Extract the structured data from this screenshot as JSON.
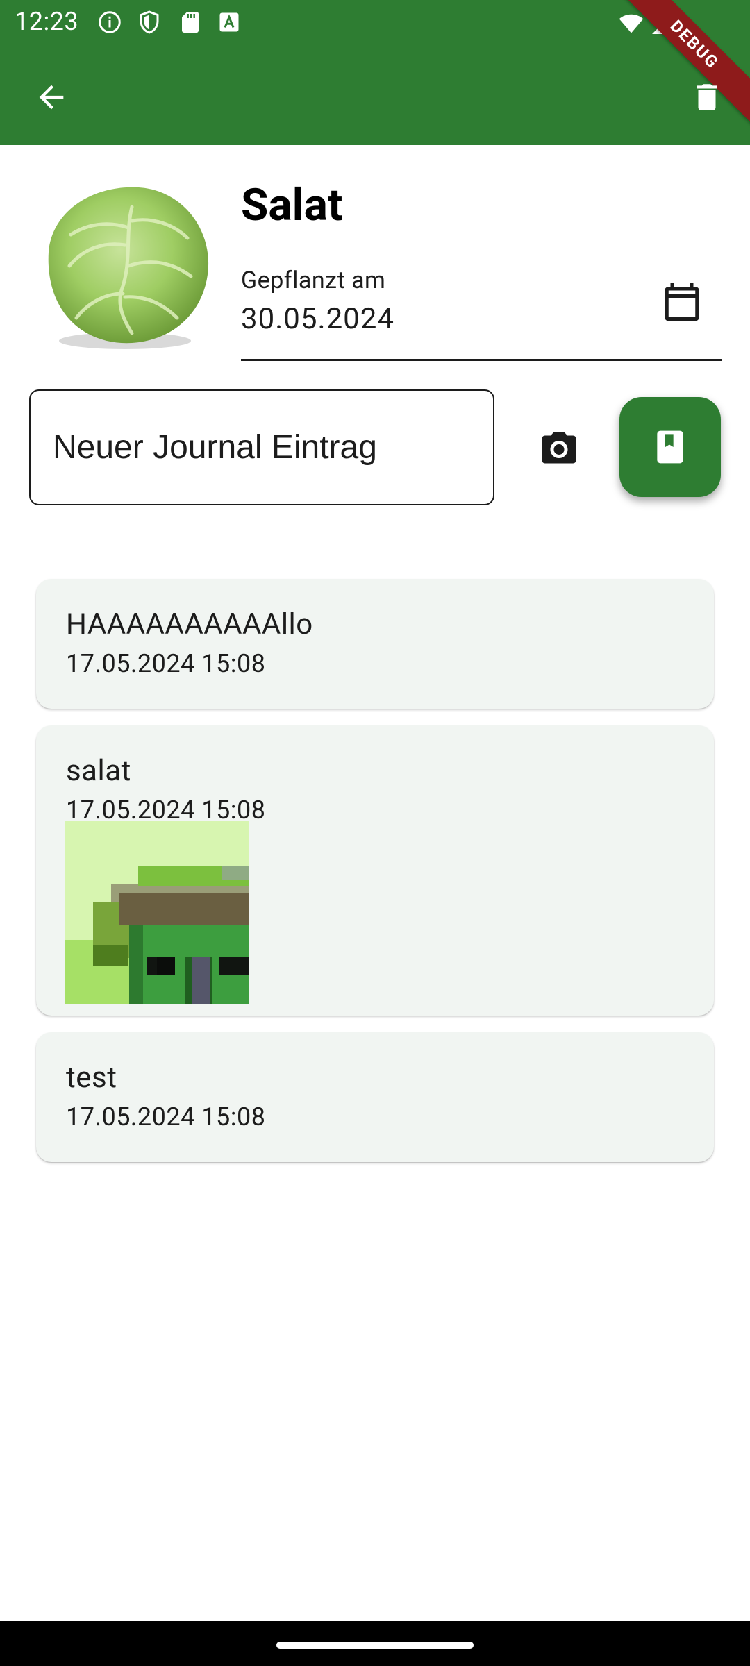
{
  "status_bar": {
    "time": "12:23",
    "icons": [
      "info-icon",
      "shield-icon",
      "sd-card-icon",
      "font-a-icon",
      "wifi-icon",
      "signal-icon"
    ],
    "debug_label": "DEBUG"
  },
  "app_bar": {
    "color": "#2e7d32",
    "back_icon": "arrow-back-icon",
    "delete_icon": "trash-icon"
  },
  "plant": {
    "name": "Salat",
    "image": "lettuce-image",
    "planted_label": "Gepflanzt am",
    "planted_date": "30.05.2024"
  },
  "journal_input": {
    "placeholder": "Neuer Journal Eintrag",
    "value": ""
  },
  "actions": {
    "camera_icon": "camera-icon",
    "save_icon": "bookmark-book-icon"
  },
  "entries": [
    {
      "text": "HAAAAAAAAAAllo",
      "date": "17.05.2024 15:08"
    },
    {
      "text": "salat",
      "date": "17.05.2024 15:08",
      "image": "pixel-house-image"
    },
    {
      "text": "test",
      "date": "17.05.2024 15:08"
    }
  ]
}
